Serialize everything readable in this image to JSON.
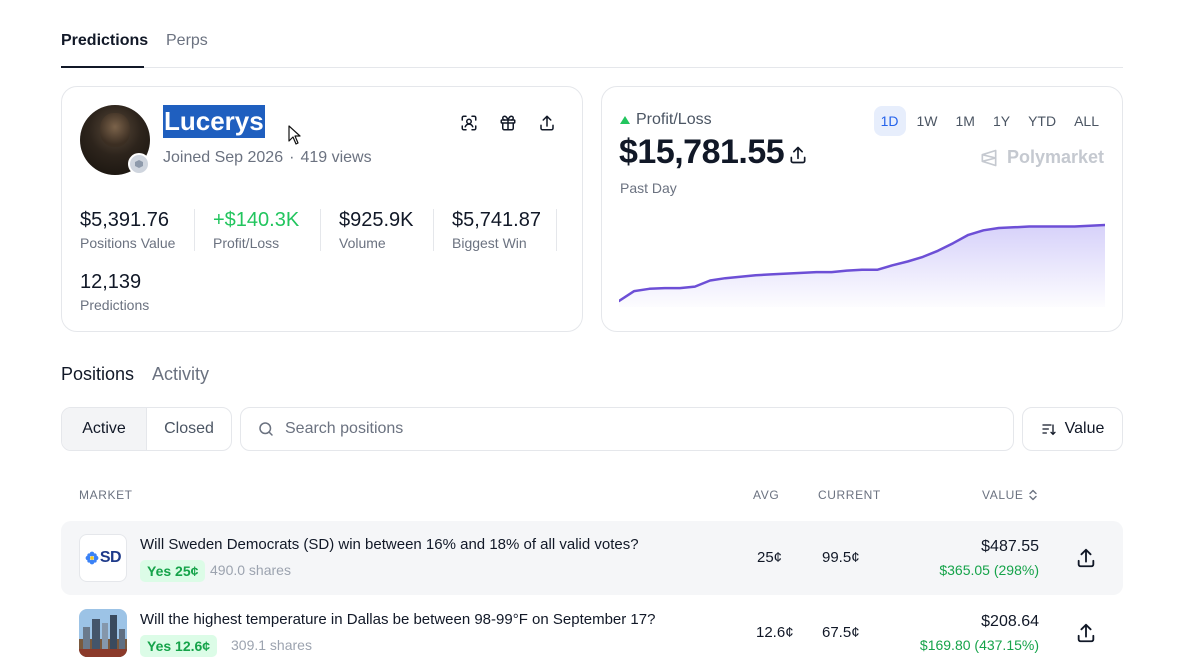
{
  "top_tabs": [
    {
      "label": "Predictions",
      "active": true
    },
    {
      "label": "Perps",
      "active": false
    }
  ],
  "profile": {
    "username": "Lucerys",
    "joined": "Joined Sep 2026",
    "separator": "·",
    "views": "419 views",
    "stats": [
      {
        "value": "$5,391.76",
        "label": "Positions Value"
      },
      {
        "value": "+$140.3K",
        "label": "Profit/Loss",
        "color": "#22c55e"
      },
      {
        "value": "$925.9K",
        "label": "Volume"
      },
      {
        "value": "$5,741.87",
        "label": "Biggest Win"
      },
      {
        "value": "12,139",
        "label": "Predictions"
      }
    ],
    "icons": [
      "scan-icon",
      "gift-icon",
      "share-icon"
    ]
  },
  "pnl": {
    "label": "Profit/Loss",
    "value": "$15,781.55",
    "period": "Past Day",
    "brand": "Polymarket",
    "ranges": [
      {
        "label": "1D",
        "active": true
      },
      {
        "label": "1W",
        "active": false
      },
      {
        "label": "1M",
        "active": false
      },
      {
        "label": "1Y",
        "active": false
      },
      {
        "label": "YTD",
        "active": false
      },
      {
        "label": "ALL",
        "active": false
      }
    ],
    "line_color": "#6d4fd6",
    "series_relative": [
      0.0,
      0.13,
      0.16,
      0.17,
      0.17,
      0.19,
      0.27,
      0.3,
      0.32,
      0.34,
      0.35,
      0.36,
      0.37,
      0.38,
      0.38,
      0.4,
      0.41,
      0.41,
      0.47,
      0.52,
      0.58,
      0.66,
      0.76,
      0.87,
      0.93,
      0.96,
      0.97,
      0.98,
      0.98,
      0.98,
      0.98,
      0.99,
      1.0
    ]
  },
  "positions": {
    "tabs": [
      {
        "label": "Positions",
        "active": true
      },
      {
        "label": "Activity",
        "active": false
      }
    ],
    "filter": {
      "active_label": "Active",
      "closed_label": "Closed"
    },
    "search_placeholder": "Search positions",
    "sort_label": "Value",
    "columns": {
      "market": "MARKET",
      "avg": "AVG",
      "current": "CURRENT",
      "value": "VALUE"
    },
    "rows": [
      {
        "title": "Will Sweden Democrats (SD) win between 16% and 18% of all valid votes?",
        "outcome": "Yes 25¢",
        "shares": "490.0 shares",
        "avg": "25¢",
        "current": "99.5¢",
        "value": "$487.55",
        "gain": "$365.05 (298%)",
        "thumb_text": "SD",
        "thumb_color": "#1e3a8a"
      },
      {
        "title": "Will the highest temperature in Dallas be between 98-99°F on September 17?",
        "outcome": "Yes 12.6¢",
        "shares": "309.1 shares",
        "avg": "12.6¢",
        "current": "67.5¢",
        "value": "$208.64",
        "gain": "$169.80 (437.15%)"
      }
    ]
  }
}
